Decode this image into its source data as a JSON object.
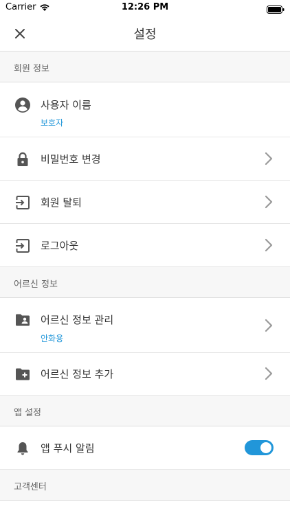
{
  "status_bar": {
    "carrier": "Carrier",
    "time": "12:26 PM"
  },
  "header": {
    "title": "설정"
  },
  "sections": {
    "member": {
      "label": "회원 정보"
    },
    "elder": {
      "label": "어르신 정보"
    },
    "app": {
      "label": "앱 설정"
    },
    "support": {
      "label": "고객센터"
    }
  },
  "rows": {
    "username": {
      "title": "사용자 이름",
      "subtitle": "보호자"
    },
    "change_password": {
      "title": "비밀번호 변경"
    },
    "withdraw": {
      "title": "회원 탈퇴"
    },
    "logout": {
      "title": "로그아웃"
    },
    "manage_elder": {
      "title": "어르신 정보 관리",
      "subtitle": "안화용"
    },
    "add_elder": {
      "title": "어르신 정보 추가"
    },
    "push": {
      "title": "앱 푸시 알림",
      "enabled": true
    }
  },
  "colors": {
    "accent": "#2196d9",
    "icon": "#555555",
    "chevron": "#999999"
  }
}
